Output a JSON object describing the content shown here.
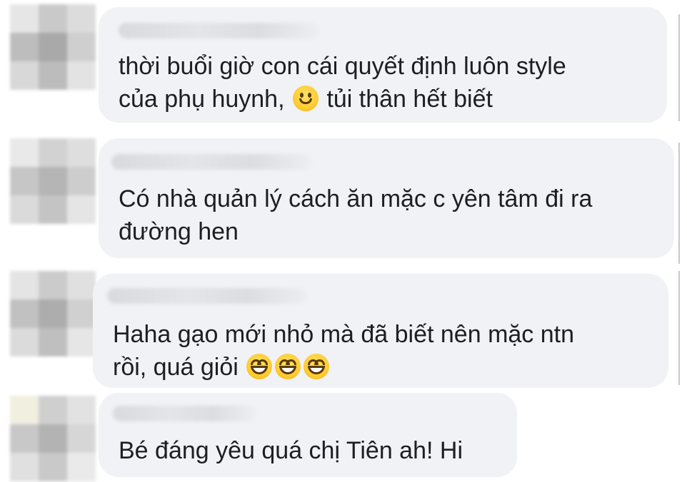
{
  "comments": [
    {
      "lines": [
        "thời buổi giờ con cái quyết định luôn style",
        "của phụ huynh,",
        "tủi thân hết biết"
      ],
      "emoji": "slightly-smiling-face"
    },
    {
      "lines": [
        "Có nhà quản lý cách ăn mặc c yên tâm đi ra",
        "đường hen"
      ]
    },
    {
      "lines": [
        "Haha gạo mới nhỏ mà đã biết nên mặc ntn",
        "rồi, quá giỏi"
      ],
      "emoji": "grinning-face-with-smiling-eyes",
      "emoji_count": 3
    },
    {
      "lines": [
        "Bé đáng yêu quá chị Tiên ah! Hi"
      ]
    }
  ],
  "colors": {
    "bubble": "#f0f2f5",
    "text": "#1c1e21",
    "background": "#ffffff"
  }
}
